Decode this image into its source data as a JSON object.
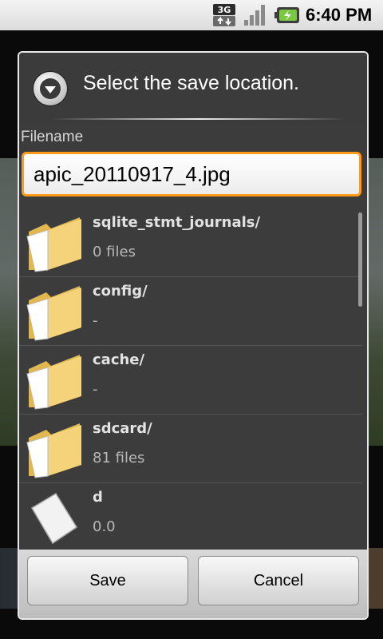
{
  "status_bar": {
    "network": "3G",
    "time": "6:40 PM"
  },
  "dialog": {
    "title": "Select the save location.",
    "filename_label": "Filename",
    "filename_value": "apic_20110917_4.jpg",
    "files": [
      {
        "name": "sqlite_stmt_journals/",
        "meta": "0 files",
        "type": "folder"
      },
      {
        "name": "config/",
        "meta": "-",
        "type": "folder"
      },
      {
        "name": "cache/",
        "meta": "-",
        "type": "folder"
      },
      {
        "name": "sdcard/",
        "meta": "81 files",
        "type": "folder"
      },
      {
        "name": "d",
        "meta": "0.0",
        "type": "file"
      }
    ],
    "buttons": {
      "save": "Save",
      "cancel": "Cancel"
    }
  },
  "colors": {
    "accent_focus": "#ff9a1a",
    "dialog_bg": "#3c3c3c"
  }
}
